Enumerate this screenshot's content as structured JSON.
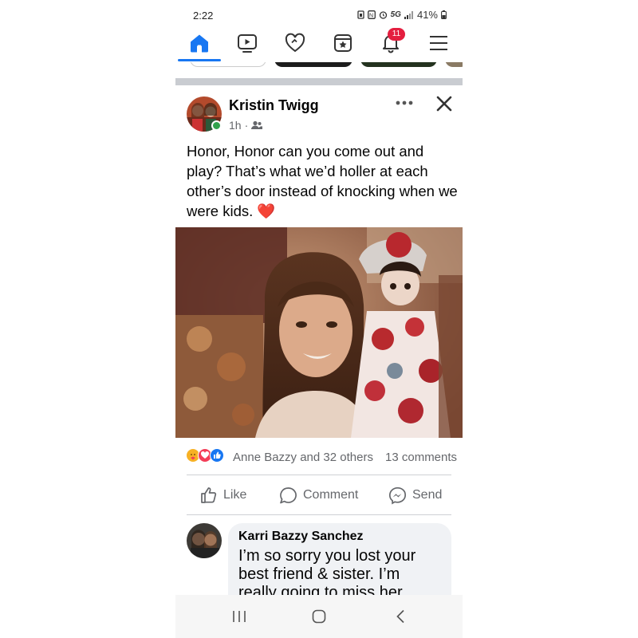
{
  "status": {
    "time": "2:22",
    "signal": "5G",
    "battery": "41%"
  },
  "nav": {
    "notification_count": "11"
  },
  "post": {
    "author": "Kristin Twigg",
    "time": "1h",
    "audience_separator": "·",
    "text": "Honor, Honor can you come out and play? That’s what we’d holler at each other’s door instead of knocking when we were kids.",
    "emoji": "❤️",
    "reactions_text": "Anne Bazzy and 32 others",
    "comments_text": "13 comments"
  },
  "actions": {
    "like": "Like",
    "comment": "Comment",
    "send": "Send"
  },
  "comment": {
    "author": "Karri Bazzy Sanchez",
    "text": "I’m so sorry you lost your best friend & sister. I’m really going to miss her."
  },
  "colors": {
    "accent": "#1877f2",
    "badge": "#e41e3f",
    "online": "#31a24c",
    "divider": "#c9ccd1"
  },
  "icons": [
    "home-icon",
    "video-icon",
    "dating-heart-icon",
    "memories-icon",
    "bell-icon",
    "menu-icon",
    "friends-audience-icon",
    "more-icon",
    "close-icon",
    "like-icon",
    "comment-icon",
    "messenger-icon",
    "recents-icon",
    "home-circle-icon",
    "back-icon"
  ]
}
